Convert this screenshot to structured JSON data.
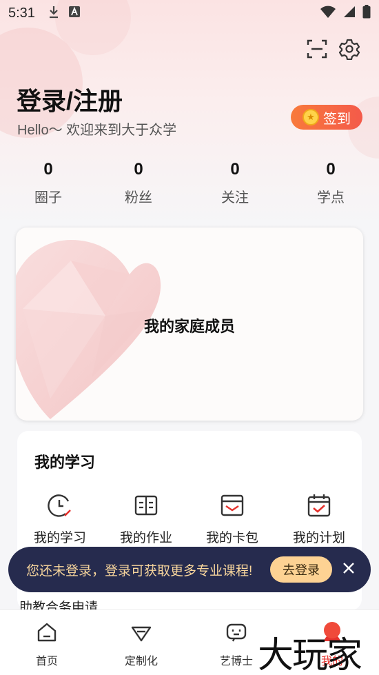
{
  "status_bar": {
    "time": "5:31"
  },
  "header": {
    "title": "登录/注册",
    "subtitle": "Hello～ 欢迎来到大于众学",
    "signin_label": "签到"
  },
  "stats": [
    {
      "value": "0",
      "label": "圈子"
    },
    {
      "value": "0",
      "label": "粉丝"
    },
    {
      "value": "0",
      "label": "关注"
    },
    {
      "value": "0",
      "label": "学点"
    }
  ],
  "family_card": {
    "label": "我的家庭成员"
  },
  "study": {
    "heading": "我的学习",
    "items": [
      {
        "label": "我的学习",
        "icon": "clock-icon"
      },
      {
        "label": "我的作业",
        "icon": "book-icon"
      },
      {
        "label": "我的卡包",
        "icon": "card-wallet-icon"
      },
      {
        "label": "我的计划",
        "icon": "calendar-check-icon"
      }
    ],
    "peek_text": "助教合务申请"
  },
  "toast": {
    "message": "您还未登录，登录可获取更多专业课程!",
    "login_label": "去登录"
  },
  "tabbar": [
    {
      "label": "首页",
      "icon": "home-icon"
    },
    {
      "label": "定制化",
      "icon": "diamond-icon"
    },
    {
      "label": "艺博士",
      "icon": "robot-icon"
    },
    {
      "label": "我的",
      "icon": "profile-icon",
      "active": true
    }
  ],
  "watermark": "大玩家",
  "colors": {
    "accent": "#e5322d",
    "toast_bg": "#262b4e",
    "toast_text": "#f7d59c",
    "signin_start": "#f87a3b",
    "signin_end": "#f45a4a"
  }
}
